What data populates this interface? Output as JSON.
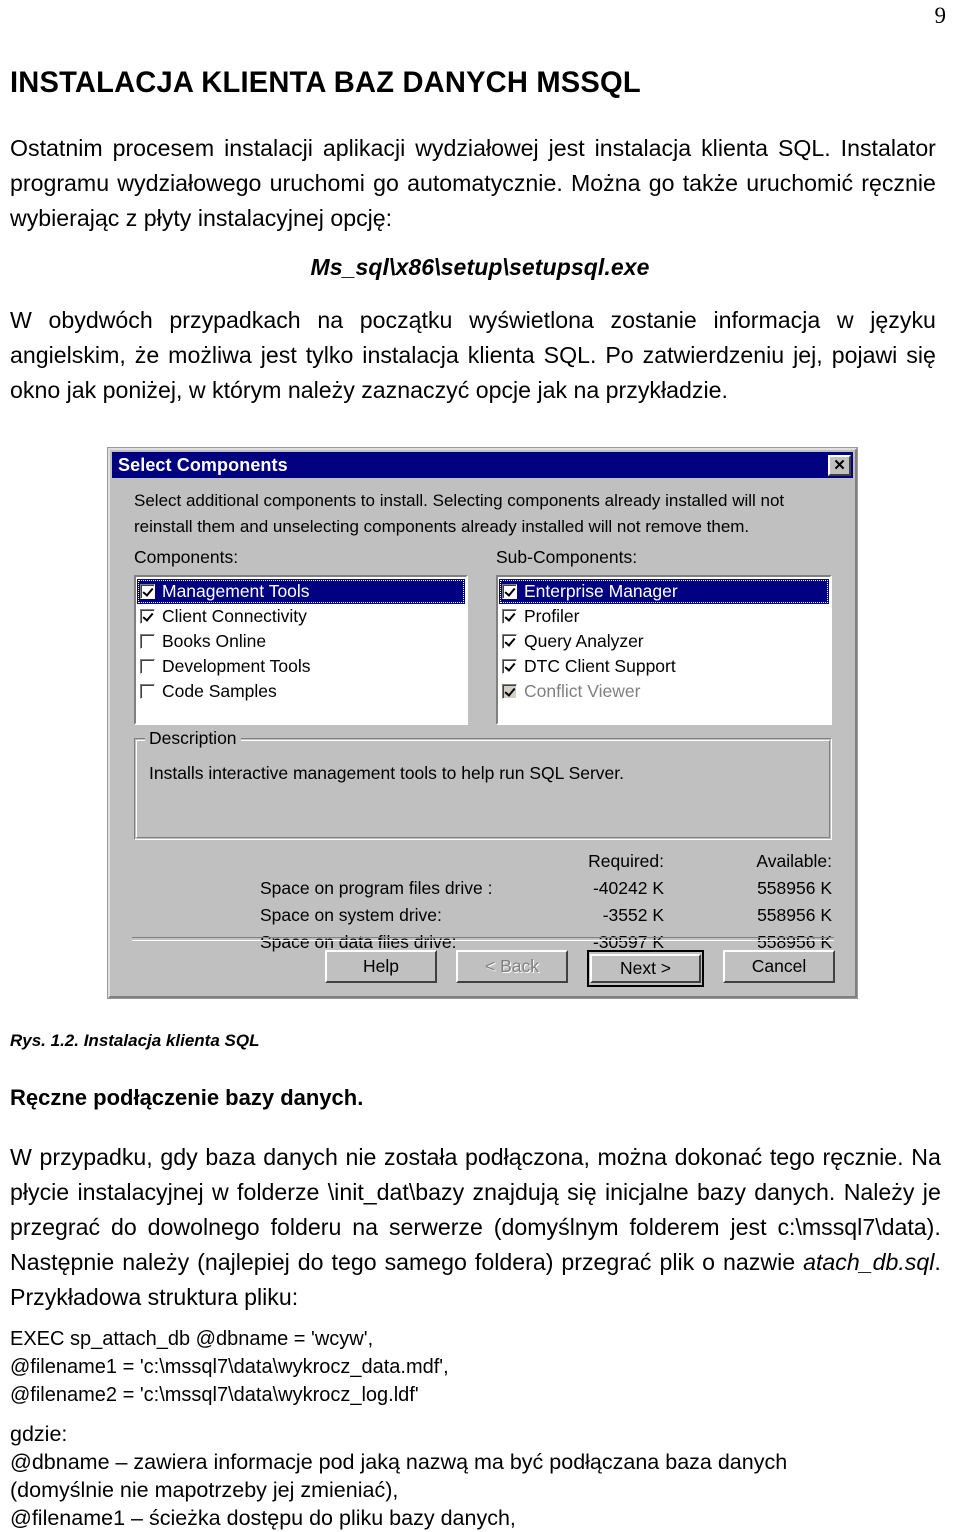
{
  "page": {
    "number": "9"
  },
  "document": {
    "title": "INSTALACJA KLIENTA BAZ DANYCH MSSQL",
    "paragraph_1": "Ostatnim procesem instalacji aplikacji wydziałowej jest instalacja klienta SQL. Instalator programu wydziałowego uruchomi go automatycznie. Można go także uruchomić ręcznie wybierając z płyty instalacyjnej opcję:",
    "path_line": "Ms_sql\\x86\\setup\\setupsql.exe",
    "paragraph_2": "W obydwóch przypadkach na początku wyświetlona zostanie informacja w języku angielskim, że możliwa jest tylko instalacja klienta SQL. Po zatwierdzeniu jej, pojawi się okno jak poniżej, w którym należy zaznaczyć opcje jak na przykładzie.",
    "figure_caption": "Rys. 1.2. Instalacja klienta SQL",
    "subheading": "Ręczne podłączenie bazy danych.",
    "paragraph_3_a": "W przypadku, gdy baza danych nie została podłączona, można dokonać tego ręcznie. Na płycie instalacyjnej w folderze \\init_dat\\bazy znajdują się inicjalne bazy danych. Należy je przegrać do dowolnego folderu na serwerze (domyślnym folderem jest c:\\mssql7\\data). Następnie należy (najlepiej do tego samego foldera) przegrać plik o nazwie ",
    "paragraph_3_italic": "atach_db.sql",
    "paragraph_3_b": ". Przykładowa struktura pliku:",
    "sql_snippet": "EXEC sp_attach_db @dbname = 'wcyw',\n@filename1 = 'c:\\mssql7\\data\\wykrocz_data.mdf',\n@filename2 = 'c:\\mssql7\\data\\wykrocz_log.ldf'",
    "tail_text": "gdzie:\n@dbname – zawiera informacje pod jaką nazwą ma być podłączana baza danych\n(domyślnie nie mapotrzeby jej zmieniać),\n@filename1 – ścieżka dostępu do pliku bazy danych,"
  },
  "dialog": {
    "title": "Select Components",
    "close_label": "✕",
    "description": "Select additional components to install. Selecting components already installed will not reinstall them and unselecting components already installed will not remove them.",
    "components_label": "Components:",
    "subcomponents_label": "Sub-Components:",
    "components": [
      {
        "label": "Management Tools",
        "checked": true,
        "selected": true,
        "disabled": false
      },
      {
        "label": "Client Connectivity",
        "checked": true,
        "selected": false,
        "disabled": false
      },
      {
        "label": "Books Online",
        "checked": false,
        "selected": false,
        "disabled": false
      },
      {
        "label": "Development Tools",
        "checked": false,
        "selected": false,
        "disabled": false
      },
      {
        "label": "Code Samples",
        "checked": false,
        "selected": false,
        "disabled": false
      }
    ],
    "subcomponents": [
      {
        "label": "Enterprise Manager",
        "checked": true,
        "selected": true,
        "disabled": false
      },
      {
        "label": "Profiler",
        "checked": true,
        "selected": false,
        "disabled": false
      },
      {
        "label": "Query Analyzer",
        "checked": true,
        "selected": false,
        "disabled": false
      },
      {
        "label": "DTC Client Support",
        "checked": true,
        "selected": false,
        "disabled": false
      },
      {
        "label": "Conflict Viewer",
        "checked": true,
        "selected": false,
        "disabled": true
      }
    ],
    "description_group": {
      "title": "Description",
      "text": "Installs interactive management tools to help run SQL Server."
    },
    "space_table": {
      "headers": [
        "",
        "Required:",
        "Available:"
      ],
      "rows": [
        {
          "label": "Space on program files drive :",
          "required": "-40242 K",
          "available": "558956 K"
        },
        {
          "label": "Space on system drive:",
          "required": "-3552 K",
          "available": "558956 K"
        },
        {
          "label": "Space on data files drive:",
          "required": "-30597 K",
          "available": "558956 K"
        }
      ]
    },
    "buttons": [
      {
        "name": "help",
        "label": "Help",
        "accel": "H",
        "disabled": false,
        "default": false
      },
      {
        "name": "back",
        "label": "< Back",
        "accel": "B",
        "disabled": true,
        "default": false
      },
      {
        "name": "next",
        "label": "Next >",
        "accel": "N",
        "disabled": false,
        "default": true
      },
      {
        "name": "cancel",
        "label": "Cancel",
        "accel": "",
        "disabled": false,
        "default": false
      }
    ]
  },
  "colors": {
    "titlebar": "#000080",
    "dialog_face": "#c0c0c0",
    "selection": "#000080",
    "disabled_text": "#808080"
  }
}
